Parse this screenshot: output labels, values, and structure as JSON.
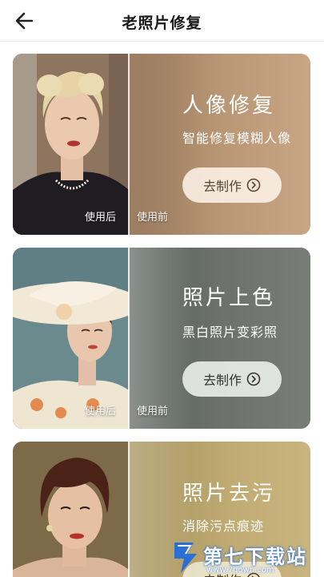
{
  "header": {
    "title": "老照片修复",
    "back_icon": "arrow-left-icon"
  },
  "cards": [
    {
      "title": "人像修复",
      "subtitle": "智能修复模糊人像",
      "button_label": "去制作",
      "after_label": "使用后",
      "before_label": "使用前",
      "accent": "#b99775"
    },
    {
      "title": "照片上色",
      "subtitle": "黑白照片变彩照",
      "button_label": "去制作",
      "after_label": "使用后",
      "before_label": "使用前",
      "accent": "#6c716c"
    },
    {
      "title": "照片去污",
      "subtitle": "消除污点痕迹",
      "button_label": "去制作",
      "accent": "#c1ac74"
    }
  ],
  "watermark": {
    "text": "第七下载站",
    "url": "www.7down.com"
  }
}
